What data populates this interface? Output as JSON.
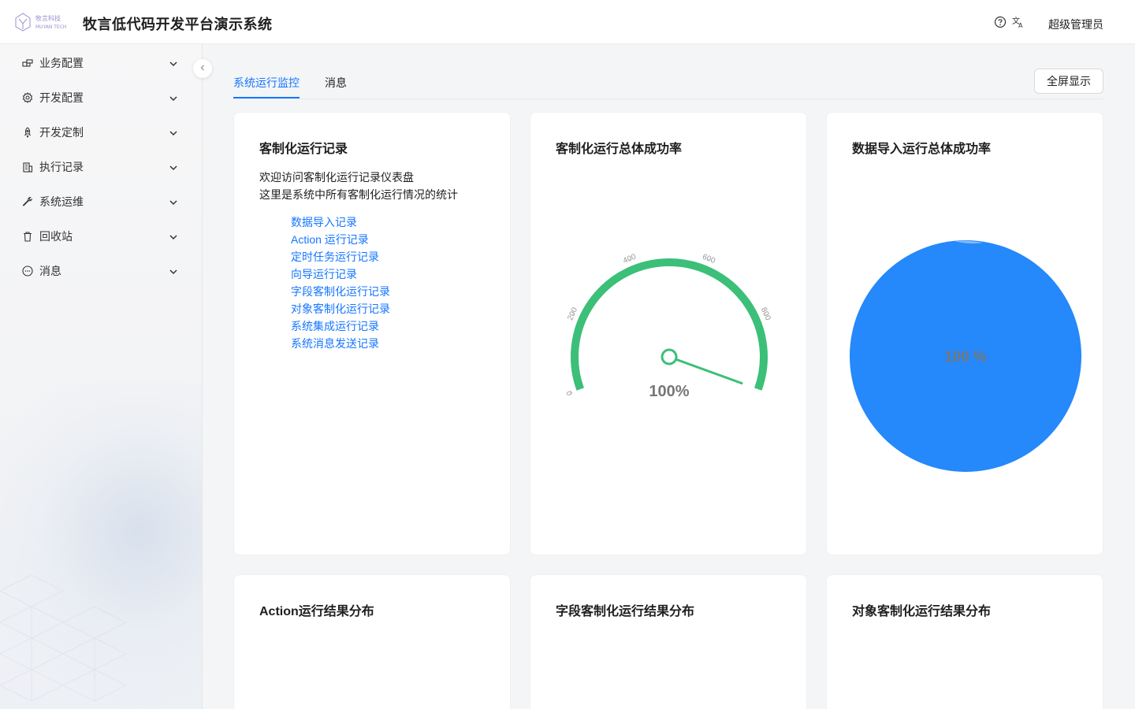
{
  "header": {
    "logo_cn": "牧言科技",
    "logo_en": "MUYAN TECH",
    "title": "牧言低代码开发平台演示系统",
    "help_icon": "question-circle-icon",
    "lang_icon": "translate-icon",
    "user": "超级管理员"
  },
  "sidebar": {
    "items": [
      {
        "label": "业务配置",
        "icon": "business-config-icon"
      },
      {
        "label": "开发配置",
        "icon": "gear-icon"
      },
      {
        "label": "开发定制",
        "icon": "rocket-icon"
      },
      {
        "label": "执行记录",
        "icon": "building-icon"
      },
      {
        "label": "系统运维",
        "icon": "wrench-icon"
      },
      {
        "label": "回收站",
        "icon": "trash-icon"
      },
      {
        "label": "消息",
        "icon": "message-icon"
      }
    ]
  },
  "tabs": [
    {
      "label": "系统运行监控",
      "active": true
    },
    {
      "label": "消息",
      "active": false
    }
  ],
  "fullscreen_label": "全屏显示",
  "cards": {
    "records": {
      "title": "客制化运行记录",
      "desc1": "欢迎访问客制化运行记录仪表盘",
      "desc2": "这里是系统中所有客制化运行情况的统计",
      "links": [
        "数据导入记录",
        "Action 运行记录",
        "定时任务运行记录",
        "向导运行记录",
        "字段客制化运行记录",
        "对象客制化运行记录",
        "系统集成运行记录",
        "系统消息发送记录"
      ]
    },
    "custom_rate": {
      "title": "客制化运行总体成功率"
    },
    "import_rate": {
      "title": "数据导入运行总体成功率"
    },
    "action_dist": {
      "title": "Action运行结果分布"
    },
    "field_dist": {
      "title": "字段客制化运行结果分布"
    },
    "object_dist": {
      "title": "对象客制化运行结果分布"
    }
  },
  "chart_data": [
    {
      "type": "gauge",
      "title": "客制化运行总体成功率",
      "ticks": [
        "0",
        "200",
        "400",
        "600",
        "800"
      ],
      "label": "100%",
      "value": 100,
      "color": "#3cbf78"
    },
    {
      "type": "pie",
      "title": "数据导入运行总体成功率",
      "label": "100 %",
      "values": [
        100
      ],
      "color": "#2588fb"
    }
  ]
}
